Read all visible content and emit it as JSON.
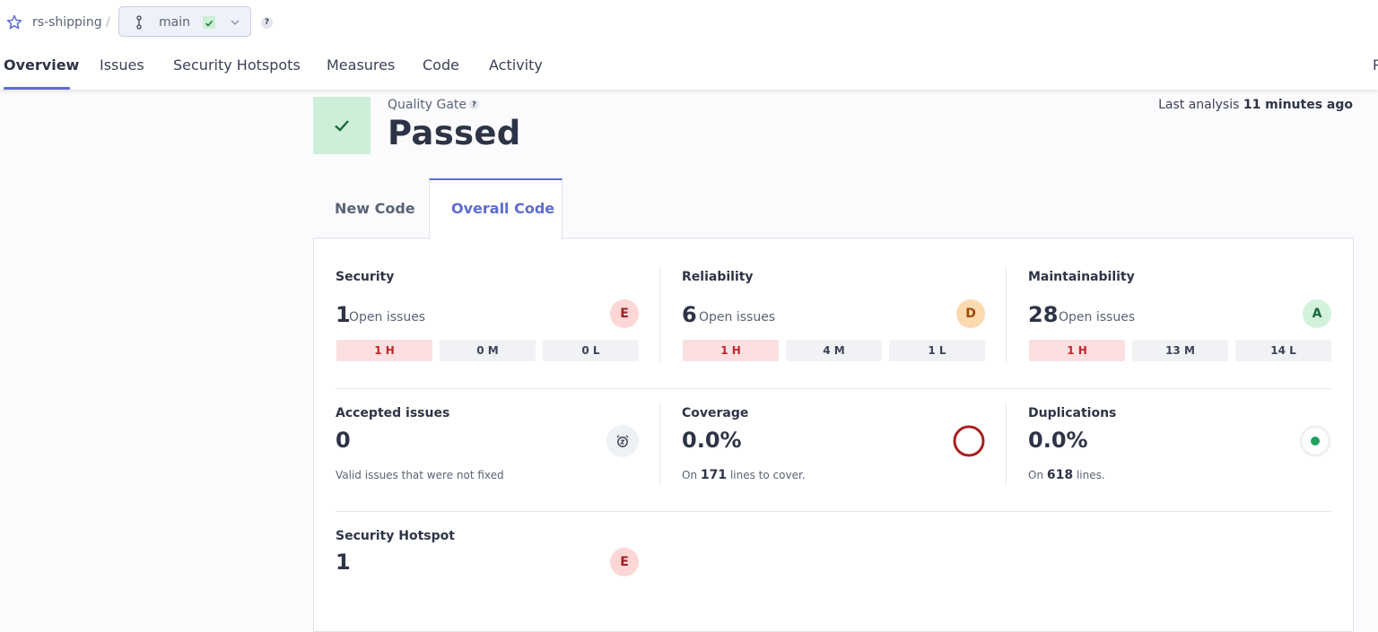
{
  "breadcrumb": {
    "project": "rs-shipping",
    "separator": "/",
    "branch": "main",
    "help": "?"
  },
  "nav": {
    "tabs": [
      "Overview",
      "Issues",
      "Security Hotspots",
      "Measures",
      "Code",
      "Activity"
    ],
    "active": "Overview",
    "cut_text": "P"
  },
  "quality_gate": {
    "label": "Quality Gate",
    "help": "?",
    "status": "Passed",
    "last_analysis_prefix": "Last analysis",
    "last_analysis_value": "11 minutes ago"
  },
  "code_tabs": {
    "new_code": "New Code",
    "overall_code": "Overall Code",
    "active": "Overall Code"
  },
  "metrics": {
    "security": {
      "title": "Security",
      "count": "1",
      "count_label": "Open issues",
      "rating": "E",
      "high": "1 H",
      "medium": "0 M",
      "low": "0 L"
    },
    "reliability": {
      "title": "Reliability",
      "count": "6",
      "count_label": "Open issues",
      "rating": "D",
      "high": "1 H",
      "medium": "4 M",
      "low": "1 L"
    },
    "maintainability": {
      "title": "Maintainability",
      "count": "28",
      "count_label": "Open issues",
      "rating": "A",
      "high": "1 H",
      "medium": "13 M",
      "low": "14 L"
    },
    "accepted": {
      "title": "Accepted issues",
      "value": "0",
      "description": "Valid issues that were not fixed"
    },
    "coverage": {
      "title": "Coverage",
      "value": "0.0%",
      "prefix": "On",
      "lines": "171",
      "suffix": "lines to cover."
    },
    "duplications": {
      "title": "Duplications",
      "value": "0.0%",
      "prefix": "On",
      "lines": "618",
      "suffix": "lines."
    },
    "hotspot": {
      "title": "Security Hotspot",
      "value": "1",
      "rating": "E"
    }
  },
  "colors": {
    "accent": "#5d6cd0",
    "passed_bg": "#cdeed7",
    "rating_e": "#fcd7d6",
    "rating_d": "#fdd9b0",
    "rating_a": "#d2f2dc",
    "coverage_ring": "#a9201f",
    "duplication_dot": "#1ea35c"
  },
  "icons": {
    "favorite": "star-outline-icon",
    "branch": "git-branch-icon",
    "branch_status": "check-icon",
    "branch_menu": "chevron-down-icon",
    "quality_gate": "check-icon",
    "accepted": "alarm-clock-icon"
  }
}
